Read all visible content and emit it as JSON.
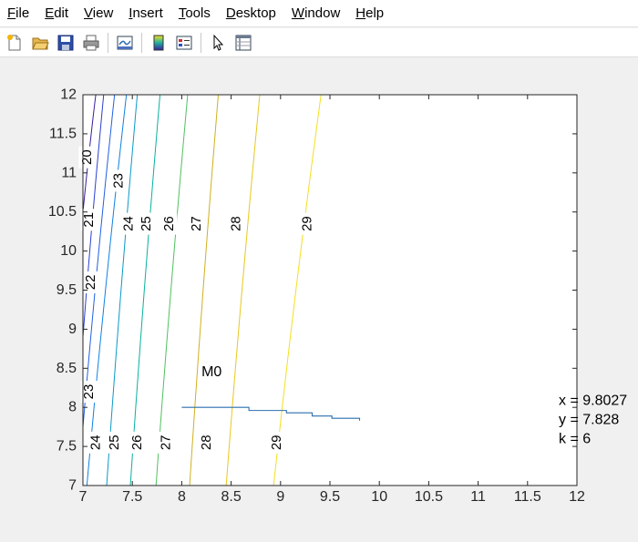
{
  "menu": [
    {
      "label": "File",
      "mnemonic": "F",
      "rest": "ile"
    },
    {
      "label": "Edit",
      "mnemonic": "E",
      "rest": "dit"
    },
    {
      "label": "View",
      "mnemonic": "V",
      "rest": "iew"
    },
    {
      "label": "Insert",
      "mnemonic": "I",
      "rest": "nsert"
    },
    {
      "label": "Tools",
      "mnemonic": "T",
      "rest": "ools"
    },
    {
      "label": "Desktop",
      "mnemonic": "D",
      "rest": "esktop"
    },
    {
      "label": "Window",
      "mnemonic": "W",
      "rest": "indow"
    },
    {
      "label": "Help",
      "mnemonic": "H",
      "rest": "elp"
    }
  ],
  "toolbar": {
    "icons": [
      "new-figure-icon",
      "open-file-icon",
      "save-icon",
      "print-icon",
      "link-plot-icon",
      "colorbar-icon",
      "legend-icon",
      "pointer-icon",
      "property-inspector-icon"
    ]
  },
  "chart_data": {
    "type": "contour",
    "xlim": [
      7,
      12
    ],
    "ylim": [
      7,
      12
    ],
    "xticks": [
      "7",
      "7.5",
      "8",
      "8.5",
      "9",
      "9.5",
      "10",
      "10.5",
      "11",
      "11.5",
      "12"
    ],
    "yticks": [
      "7",
      "7.5",
      "8",
      "8.5",
      "9",
      "9.5",
      "10",
      "10.5",
      "11",
      "11.5",
      "12"
    ],
    "grid": false,
    "contours": [
      {
        "level": 20,
        "color": "#3a1e9c",
        "bottom_x": 7.0,
        "top_x": 7.13,
        "bottom_y": 10.5,
        "labels": [
          {
            "text": "20",
            "x": 7.04,
            "y": 11.2
          }
        ]
      },
      {
        "level": 21,
        "color": "#2b3fcf",
        "bottom_x": 7.0,
        "top_x": 7.21,
        "bottom_y": 8.9,
        "labels": [
          {
            "text": "21",
            "x": 7.06,
            "y": 10.4
          }
        ]
      },
      {
        "level": 22,
        "color": "#2060e0",
        "bottom_x": 7.0,
        "top_x": 7.32,
        "bottom_y": 7.75,
        "labels": [
          {
            "text": "22",
            "x": 7.08,
            "y": 9.6
          }
        ]
      },
      {
        "level": 23,
        "color": "#1080e0",
        "bottom_x": 7.04,
        "top_x": 7.44,
        "labels": [
          {
            "text": "23",
            "x": 7.36,
            "y": 10.9
          },
          {
            "text": "23",
            "x": 7.06,
            "y": 8.2
          }
        ]
      },
      {
        "level": 24,
        "color": "#0a99c8",
        "bottom_x": 7.24,
        "top_x": 7.55,
        "labels": [
          {
            "text": "24",
            "x": 7.46,
            "y": 10.35
          },
          {
            "text": "24",
            "x": 7.13,
            "y": 7.55
          }
        ]
      },
      {
        "level": 25,
        "color": "#0ab0a0",
        "bottom_x": 7.48,
        "top_x": 7.78,
        "labels": [
          {
            "text": "25",
            "x": 7.64,
            "y": 10.35
          },
          {
            "text": "25",
            "x": 7.32,
            "y": 7.55
          }
        ]
      },
      {
        "level": 26,
        "color": "#50c060",
        "bottom_x": 7.74,
        "top_x": 8.06,
        "labels": [
          {
            "text": "26",
            "x": 7.87,
            "y": 10.35
          },
          {
            "text": "26",
            "x": 7.55,
            "y": 7.55
          }
        ]
      },
      {
        "level": 27,
        "color": "#d0b020",
        "bottom_x": 8.08,
        "top_x": 8.37,
        "labels": [
          {
            "text": "27",
            "x": 8.15,
            "y": 10.35
          },
          {
            "text": "27",
            "x": 7.84,
            "y": 7.55
          }
        ]
      },
      {
        "level": 28,
        "color": "#e8c820",
        "bottom_x": 8.45,
        "top_x": 8.79,
        "labels": [
          {
            "text": "28",
            "x": 8.55,
            "y": 10.35
          },
          {
            "text": "28",
            "x": 8.25,
            "y": 7.55
          }
        ]
      },
      {
        "level": 29,
        "color": "#f2e020",
        "bottom_x": 8.93,
        "top_x": 9.41,
        "labels": [
          {
            "text": "29",
            "x": 9.27,
            "y": 10.35
          },
          {
            "text": "29",
            "x": 8.96,
            "y": 7.55
          }
        ]
      }
    ],
    "path": {
      "color": "#2a6fb0",
      "x": [
        8.0,
        8.68,
        8.68,
        9.06,
        9.06,
        9.32,
        9.32,
        9.52,
        9.52,
        9.8,
        9.8
      ],
      "y": [
        8.0,
        8.0,
        7.96,
        7.96,
        7.93,
        7.93,
        7.89,
        7.89,
        7.86,
        7.86,
        7.83
      ]
    },
    "annotations": [
      {
        "text": "M0",
        "x": 8.2,
        "y": 8.45,
        "align": "start"
      }
    ],
    "readout": {
      "x_label": "x = 9.8027",
      "y_label": "y = 7.828",
      "k_label": "k = 6"
    }
  }
}
